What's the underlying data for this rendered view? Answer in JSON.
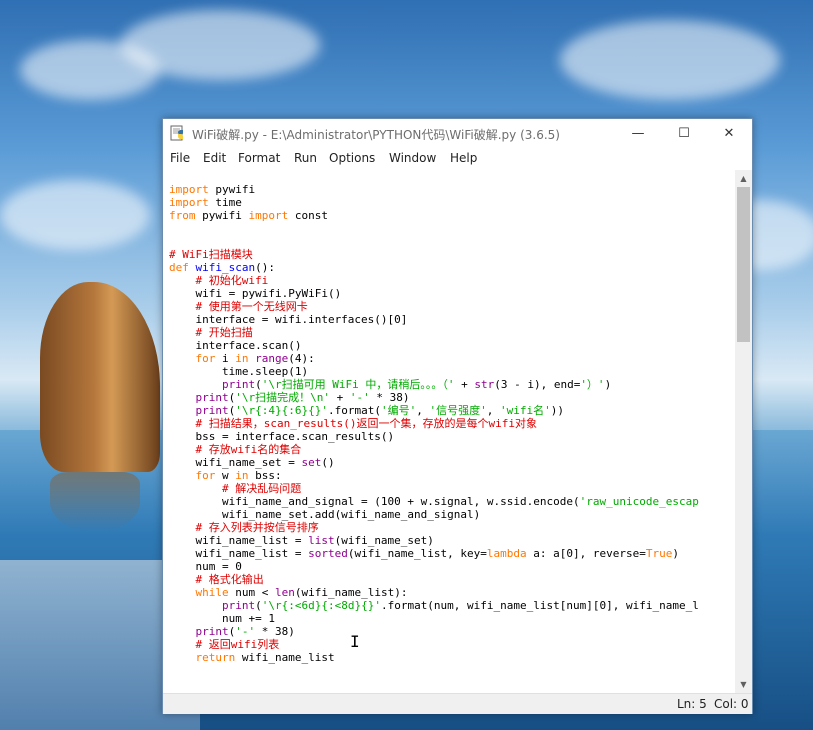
{
  "window": {
    "title": "WiFi破解.py - E:\\Administrator\\PYTHON代码\\WiFi破解.py (3.6.5)",
    "controls": {
      "minimize": "—",
      "maximize": "☐",
      "close": "✕"
    },
    "app_icon": "python-idle-icon"
  },
  "menu": [
    "File",
    "Edit",
    "Format",
    "Run",
    "Options",
    "Window",
    "Help"
  ],
  "editor": {
    "lines": [
      [
        [
          "import",
          "kw"
        ],
        [
          " pywifi",
          ""
        ]
      ],
      [
        [
          "import",
          "kw"
        ],
        [
          " time",
          ""
        ]
      ],
      [
        [
          "from",
          "kw"
        ],
        [
          " pywifi ",
          ""
        ],
        [
          "import",
          "kw"
        ],
        [
          " const",
          ""
        ]
      ],
      [],
      [],
      [
        [
          "# WiFi扫描模块",
          "cm"
        ]
      ],
      [
        [
          "def",
          "kw"
        ],
        [
          " ",
          ""
        ],
        [
          "wifi_scan",
          "df"
        ],
        [
          "():",
          ""
        ]
      ],
      [
        [
          "    ",
          ""
        ],
        [
          "# 初始化wifi",
          "cm"
        ]
      ],
      [
        [
          "    wifi = pywifi.PyWiFi()",
          ""
        ]
      ],
      [
        [
          "    ",
          ""
        ],
        [
          "# 使用第一个无线网卡",
          "cm"
        ]
      ],
      [
        [
          "    interface = wifi.interfaces()[0]",
          ""
        ]
      ],
      [
        [
          "    ",
          ""
        ],
        [
          "# 开始扫描",
          "cm"
        ]
      ],
      [
        [
          "    interface.scan()",
          ""
        ]
      ],
      [
        [
          "    ",
          ""
        ],
        [
          "for",
          "kw"
        ],
        [
          " i ",
          ""
        ],
        [
          "in",
          "kw"
        ],
        [
          " ",
          ""
        ],
        [
          "range",
          "bi"
        ],
        [
          "(4):",
          ""
        ]
      ],
      [
        [
          "        time.sleep(1)",
          ""
        ]
      ],
      [
        [
          "        ",
          ""
        ],
        [
          "print",
          "bi"
        ],
        [
          "(",
          ""
        ],
        [
          "'\\r扫描可用 WiFi 中，请稍后。。。（'",
          "st"
        ],
        [
          " + ",
          ""
        ],
        [
          "str",
          "bi"
        ],
        [
          "(3 - i), end=",
          ""
        ],
        [
          "'）'",
          "st"
        ],
        [
          ")",
          ""
        ]
      ],
      [
        [
          "    ",
          ""
        ],
        [
          "print",
          "bi"
        ],
        [
          "(",
          ""
        ],
        [
          "'\\r扫描完成！\\n'",
          "st"
        ],
        [
          " + ",
          ""
        ],
        [
          "'-'",
          "st"
        ],
        [
          " * 38)",
          ""
        ]
      ],
      [
        [
          "    ",
          ""
        ],
        [
          "print",
          "bi"
        ],
        [
          "(",
          ""
        ],
        [
          "'\\r{:4}{:6}{}'",
          "st"
        ],
        [
          ".format(",
          ""
        ],
        [
          "'编号'",
          "st"
        ],
        [
          ", ",
          ""
        ],
        [
          "'信号强度'",
          "st"
        ],
        [
          ", ",
          ""
        ],
        [
          "'wifi名'",
          "st"
        ],
        [
          "))",
          ""
        ]
      ],
      [
        [
          "    ",
          ""
        ],
        [
          "# 扫描结果，scan_results()返回一个集，存放的是每个wifi对象",
          "cm"
        ]
      ],
      [
        [
          "    bss = interface.scan_results()",
          ""
        ]
      ],
      [
        [
          "    ",
          ""
        ],
        [
          "# 存放wifi名的集合",
          "cm"
        ]
      ],
      [
        [
          "    wifi_name_set = ",
          ""
        ],
        [
          "set",
          "bi"
        ],
        [
          "()",
          ""
        ]
      ],
      [
        [
          "    ",
          ""
        ],
        [
          "for",
          "kw"
        ],
        [
          " w ",
          ""
        ],
        [
          "in",
          "kw"
        ],
        [
          " bss:",
          ""
        ]
      ],
      [
        [
          "        ",
          ""
        ],
        [
          "# 解决乱码问题",
          "cm"
        ]
      ],
      [
        [
          "        wifi_name_and_signal = (100 + w.signal, w.ssid.encode(",
          ""
        ],
        [
          "'raw_unicode_escap",
          "st"
        ]
      ],
      [
        [
          "        wifi_name_set.add(wifi_name_and_signal)",
          ""
        ]
      ],
      [
        [
          "    ",
          ""
        ],
        [
          "# 存入列表并按信号排序",
          "cm"
        ]
      ],
      [
        [
          "    wifi_name_list = ",
          ""
        ],
        [
          "list",
          "bi"
        ],
        [
          "(wifi_name_set)",
          ""
        ]
      ],
      [
        [
          "    wifi_name_list = ",
          ""
        ],
        [
          "sorted",
          "bi"
        ],
        [
          "(wifi_name_list, key=",
          ""
        ],
        [
          "lambda",
          "kw"
        ],
        [
          " a: a[0], reverse=",
          ""
        ],
        [
          "True",
          "kw"
        ],
        [
          ")",
          ""
        ]
      ],
      [
        [
          "    num = 0",
          ""
        ]
      ],
      [
        [
          "    ",
          ""
        ],
        [
          "# 格式化输出",
          "cm"
        ]
      ],
      [
        [
          "    ",
          ""
        ],
        [
          "while",
          "kw"
        ],
        [
          " num < ",
          ""
        ],
        [
          "len",
          "bi"
        ],
        [
          "(wifi_name_list):",
          ""
        ]
      ],
      [
        [
          "        ",
          ""
        ],
        [
          "print",
          "bi"
        ],
        [
          "(",
          ""
        ],
        [
          "'\\r{:<6d}{:<8d}{}'",
          "st"
        ],
        [
          ".format(num, wifi_name_list[num][0], wifi_name_l",
          ""
        ]
      ],
      [
        [
          "        num += 1",
          ""
        ]
      ],
      [
        [
          "    ",
          ""
        ],
        [
          "print",
          "bi"
        ],
        [
          "(",
          ""
        ],
        [
          "'-'",
          "st"
        ],
        [
          " * 38)",
          ""
        ]
      ],
      [
        [
          "    ",
          ""
        ],
        [
          "# 返回wifi列表",
          "cm"
        ]
      ],
      [
        [
          "    ",
          ""
        ],
        [
          "return",
          "kw"
        ],
        [
          " wifi_name_list",
          ""
        ]
      ]
    ]
  },
  "scrollbar": {
    "up_icon": "▲",
    "down_icon": "▼"
  },
  "status": {
    "line": "Ln: 5",
    "col": "Col: 0"
  },
  "cursor": "I"
}
